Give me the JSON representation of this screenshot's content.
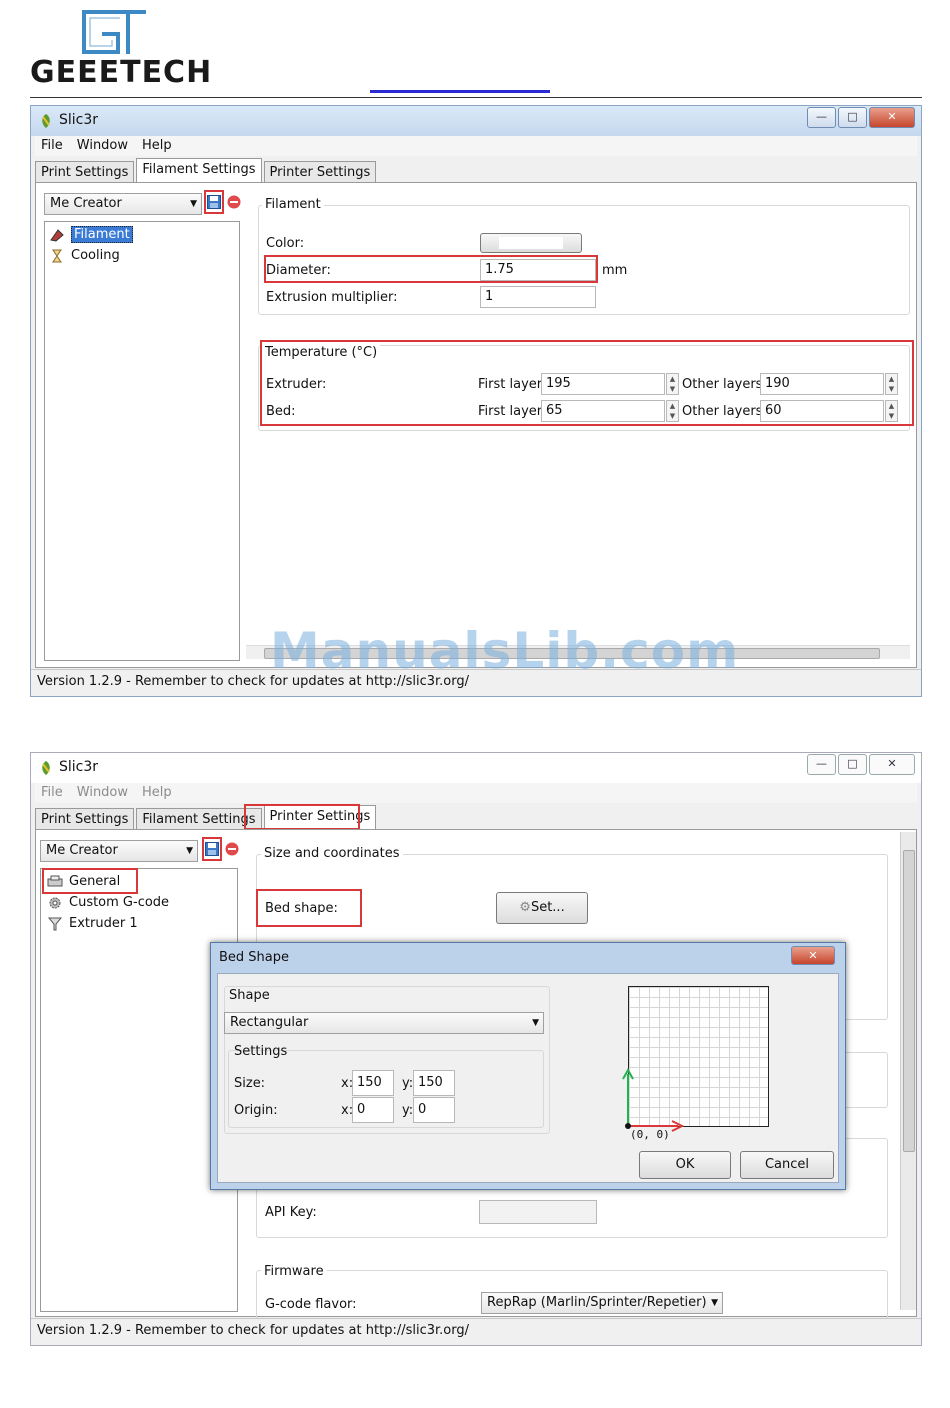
{
  "header": {
    "brand": "GEEETECH"
  },
  "window1": {
    "title": "Slic3r",
    "menu": [
      "File",
      "Window",
      "Help"
    ],
    "tabs": [
      "Print Settings",
      "Filament Settings",
      "Printer Settings"
    ],
    "active_tab": "Filament Settings",
    "preset": "Me Creator",
    "tree": [
      "Filament",
      "Cooling"
    ],
    "filament_group": {
      "title": "Filament",
      "color_label": "Color:",
      "diameter_label": "Diameter:",
      "diameter_value": "1.75",
      "diameter_unit": "mm",
      "extrusion_label": "Extrusion multiplier:",
      "extrusion_value": "1"
    },
    "temperature_group": {
      "title": "Temperature (°C)",
      "extruder_label": "Extruder:",
      "bed_label": "Bed:",
      "first_layer_label": "First layer:",
      "other_layers_label": "Other layers:",
      "extruder_first": "195",
      "extruder_other": "190",
      "bed_first": "65",
      "bed_other": "60"
    },
    "status": "Version 1.2.9 - Remember to check for updates at http://slic3r.org/"
  },
  "watermark": "ManualsLib.com",
  "window2": {
    "title": "Slic3r",
    "menu": [
      "File",
      "Window",
      "Help"
    ],
    "tabs": [
      "Print Settings",
      "Filament Settings",
      "Printer Settings"
    ],
    "active_tab": "Printer Settings",
    "preset": "Me Creator",
    "tree": [
      "General",
      "Custom G-code",
      "Extruder 1"
    ],
    "size_group_title": "Size and coordinates",
    "bed_shape_label": "Bed shape:",
    "set_button": "Set...",
    "api_key_label": "API Key:",
    "firmware_group_title": "Firmware",
    "gcode_flavor_label": "G-code flavor:",
    "gcode_flavor_value": "RepRap (Marlin/Sprinter/Repetier)",
    "status": "Version 1.2.9 - Remember to check for updates at http://slic3r.org/"
  },
  "bed_shape_dialog": {
    "title": "Bed Shape",
    "shape_group": "Shape",
    "shape_value": "Rectangular",
    "settings_group": "Settings",
    "size_label": "Size:",
    "origin_label": "Origin:",
    "x_label": "x:",
    "y_label": "y:",
    "size_x": "150",
    "size_y": "150",
    "origin_x": "0",
    "origin_y": "0",
    "origin_caption": "(0, 0)",
    "ok": "OK",
    "cancel": "Cancel"
  },
  "colors": {
    "highlight": "#d9383b",
    "selection": "#3a7bd5",
    "axis_x": "#d9383b",
    "axis_y": "#22b14c"
  }
}
